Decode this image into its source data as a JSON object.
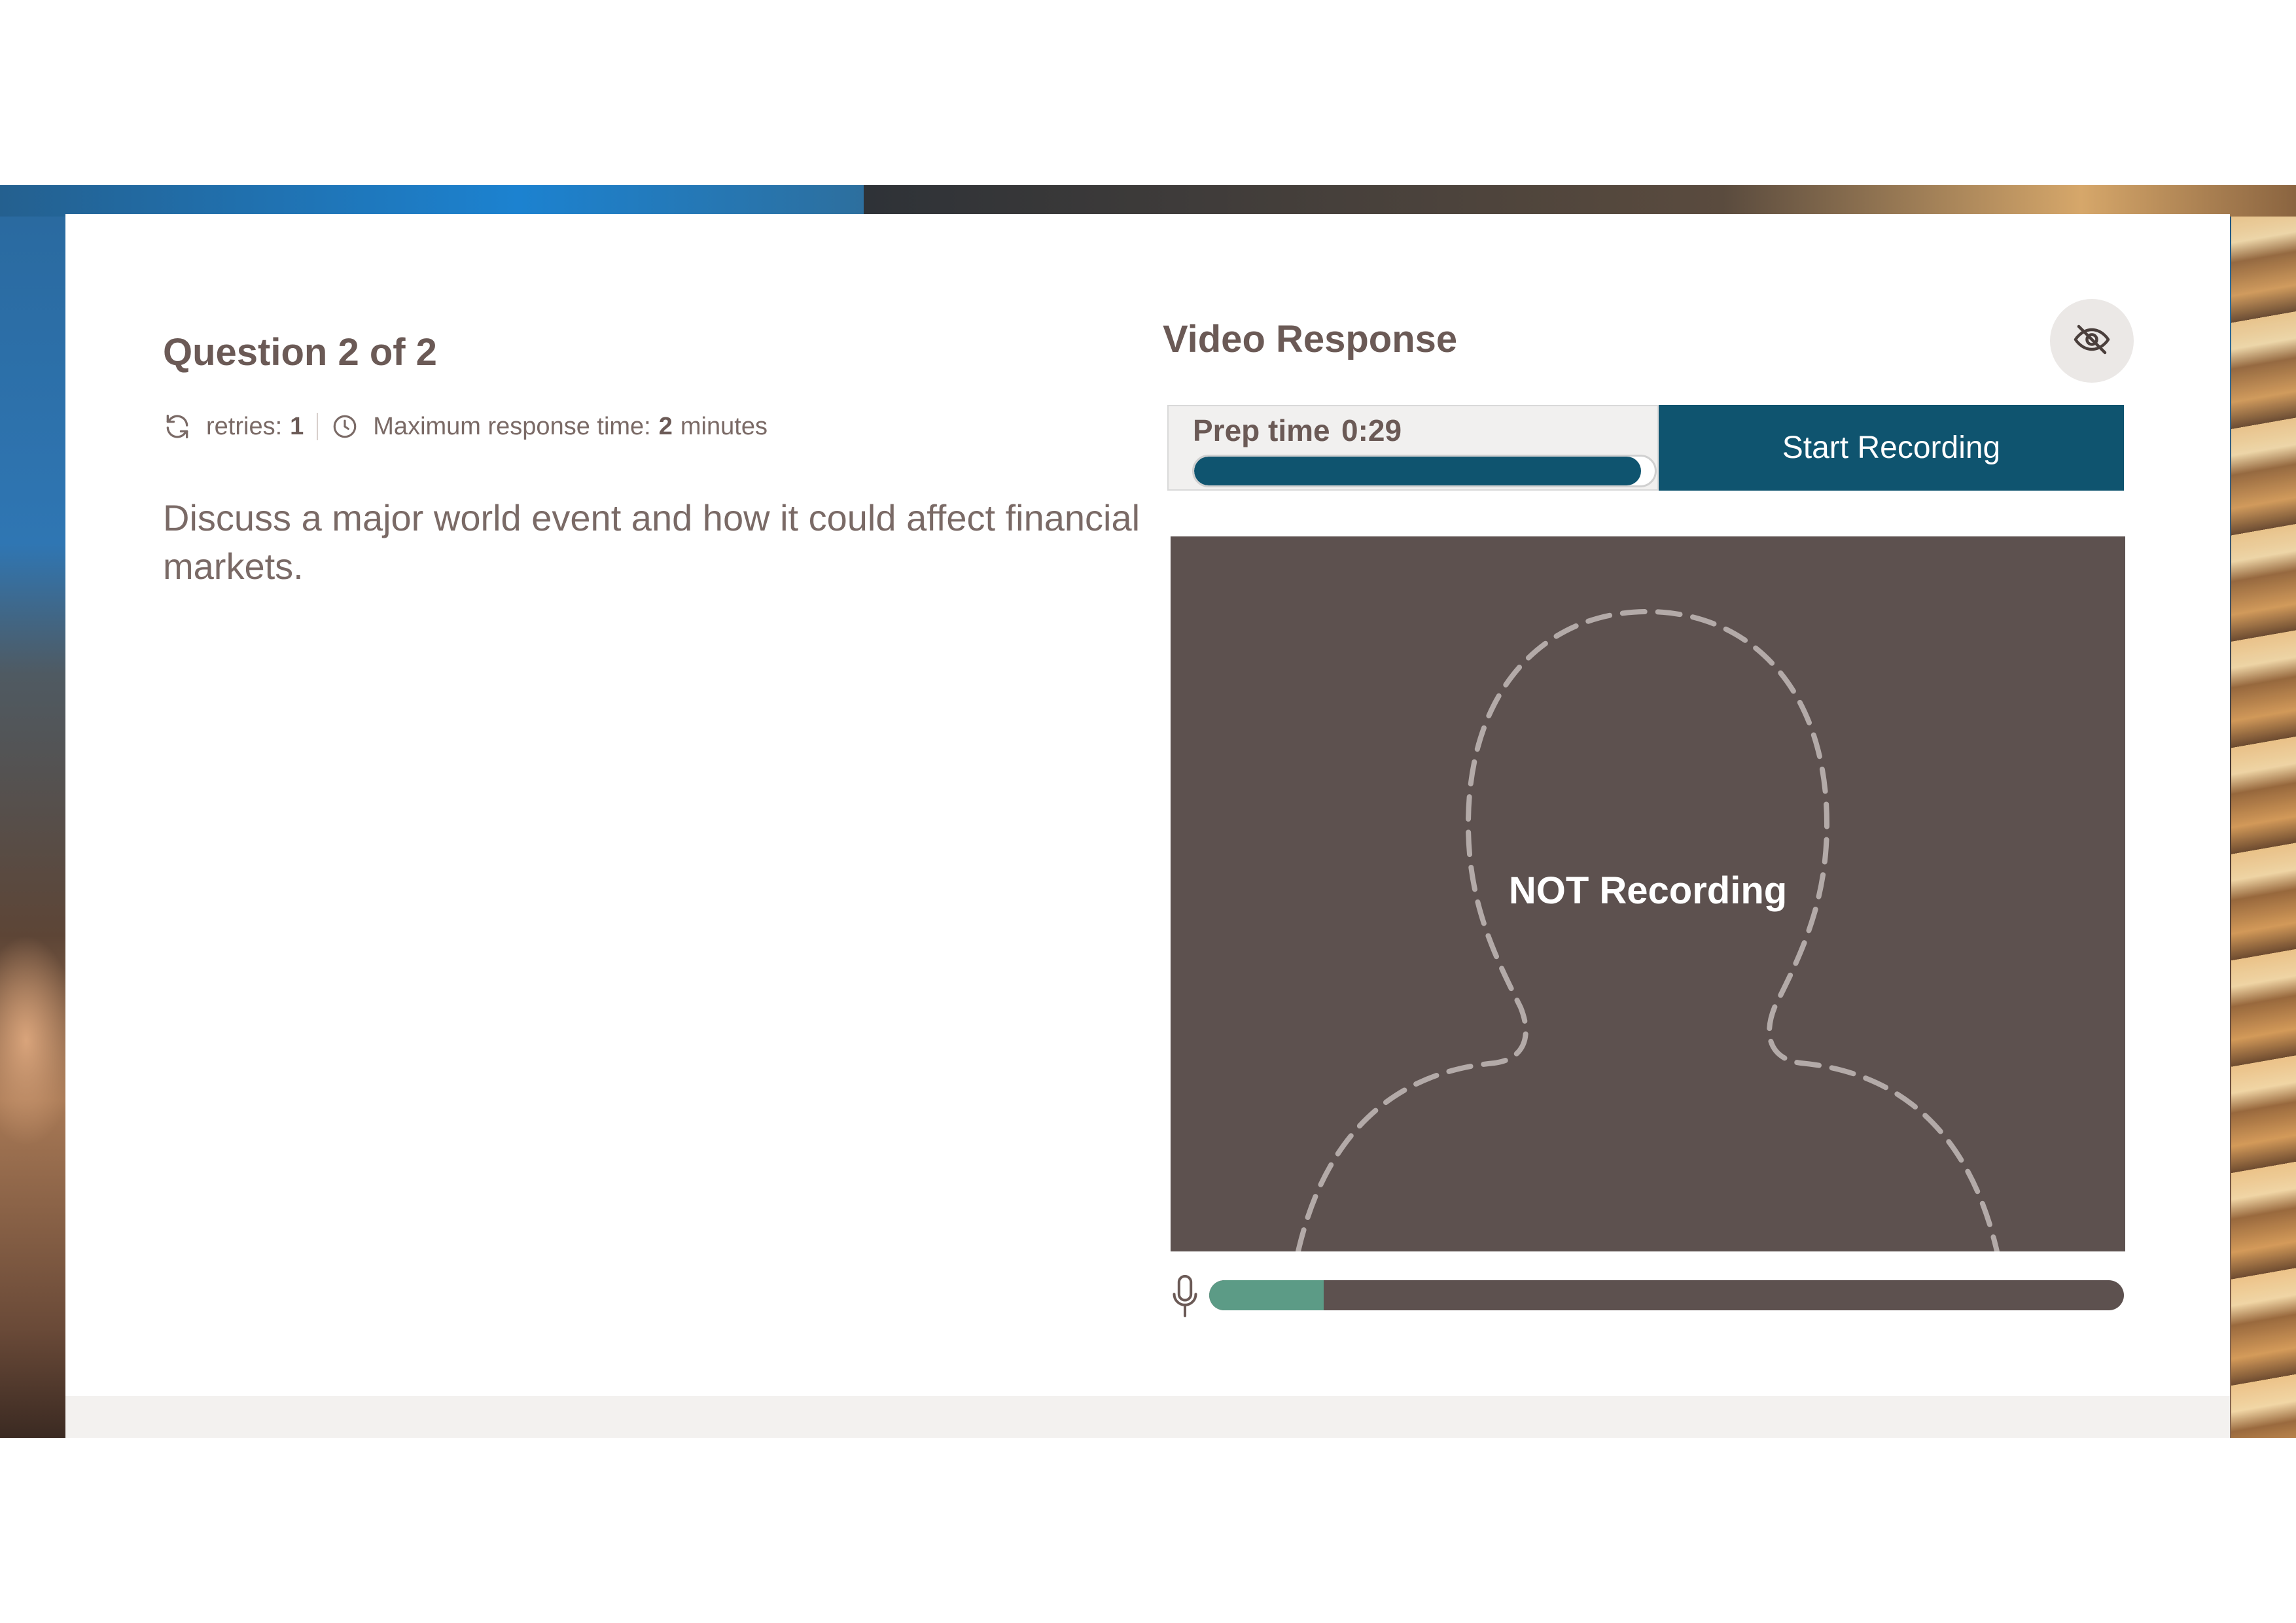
{
  "question": {
    "title": "Question 2 of 2",
    "retries_label": "retries:",
    "retries_value": "1",
    "max_time_label": "Maximum response time:",
    "max_time_value": "2",
    "max_time_unit": "minutes",
    "prompt": "Discuss a major world event and how it could affect financial markets."
  },
  "video": {
    "title": "Video Response",
    "prep_label": "Prep time",
    "prep_time": "0:29",
    "prep_progress_fraction": 0.97,
    "start_button_label": "Start Recording",
    "status_text": "NOT Recording",
    "audio_level_fraction": 0.125
  },
  "icons": {
    "retry": "refresh-icon",
    "clock": "clock-icon",
    "hide": "eye-slash-icon",
    "mic": "microphone-icon",
    "placeholder": "person-silhouette-icon"
  },
  "colors": {
    "accent": "#0f546f",
    "video_bg": "#5d514f",
    "audio_level": "#5c9b86",
    "text": "#6b5a56"
  }
}
